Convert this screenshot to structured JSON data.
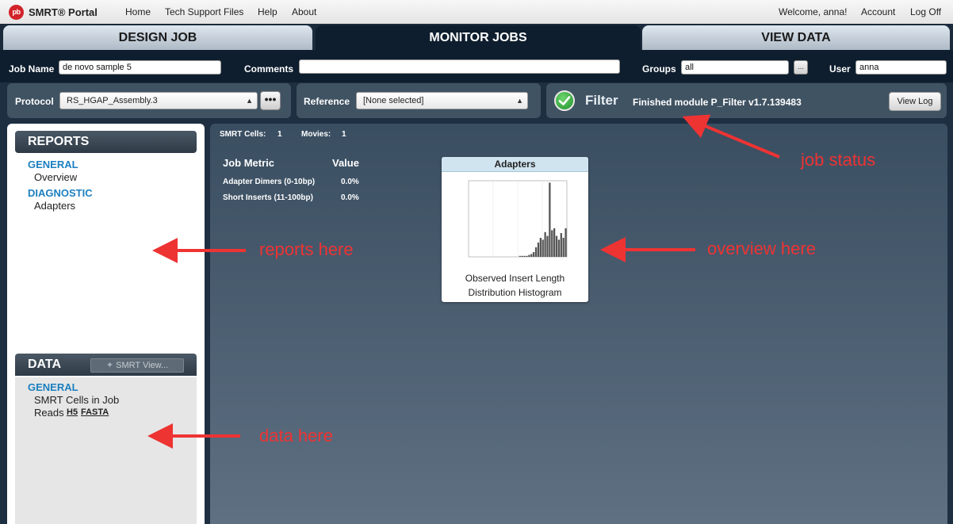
{
  "app": {
    "logo_mark": "pb",
    "name": "SMRT® Portal"
  },
  "menu": {
    "home": "Home",
    "tech_support": "Tech Support Files",
    "help": "Help",
    "about": "About"
  },
  "user_menu": {
    "welcome": "Welcome, anna!",
    "account": "Account",
    "logoff": "Log Off"
  },
  "tabs": [
    {
      "label": "DESIGN JOB",
      "active": false
    },
    {
      "label": "MONITOR JOBS",
      "active": true
    },
    {
      "label": "VIEW DATA",
      "active": false
    }
  ],
  "job": {
    "name_label": "Job Name",
    "name_value": "de novo sample 5",
    "comments_label": "Comments",
    "comments_value": "",
    "groups_label": "Groups",
    "groups_value": "all",
    "groups_btn": "...",
    "user_label": "User",
    "user_value": "anna"
  },
  "protocol": {
    "label": "Protocol",
    "value": "RS_HGAP_Assembly.3",
    "more_btn": "•••"
  },
  "reference": {
    "label": "Reference",
    "value": "[None selected]"
  },
  "status": {
    "name": "Filter",
    "message": "Finished module P_Filter v1.7.139483",
    "view_log": "View Log",
    "icon": "checkmark-icon",
    "color": "#2a9d36"
  },
  "reports": {
    "header": "REPORTS",
    "groups": [
      {
        "category": "GENERAL",
        "items": [
          "Overview"
        ]
      },
      {
        "category": "DIAGNOSTIC",
        "items": [
          "Adapters"
        ]
      }
    ]
  },
  "data_panel": {
    "header": "DATA",
    "smrt_view_btn": "SMRT View...",
    "category": "GENERAL",
    "item1": "SMRT Cells in Job",
    "reads_label": "Reads",
    "reads_h5": "H5",
    "reads_fasta": "FASTA"
  },
  "summary": {
    "cells_label": "SMRT Cells:",
    "cells_value": "1",
    "movies_label": "Movies:",
    "movies_value": "1"
  },
  "metrics": {
    "col_metric": "Job Metric",
    "col_value": "Value",
    "rows": [
      {
        "metric": "Adapter Dimers (0-10bp)",
        "value": "0.0%"
      },
      {
        "metric": "Short Inserts (11-100bp)",
        "value": "0.0%"
      }
    ]
  },
  "adapters_card": {
    "title": "Adapters",
    "caption_line1": "Observed Insert Length",
    "caption_line2": "Distribution Histogram"
  },
  "chart_data": {
    "type": "bar",
    "values": [
      0,
      0,
      0,
      0,
      0,
      0,
      0,
      0,
      0,
      0,
      0,
      0,
      0,
      0,
      0,
      0,
      0,
      0,
      0,
      0,
      0,
      0,
      1,
      1,
      1,
      1,
      2,
      3,
      5,
      10,
      15,
      20,
      18,
      26,
      22,
      78,
      28,
      30,
      22,
      18,
      25,
      20,
      30
    ],
    "ylim": [
      0,
      80
    ]
  },
  "annotations": {
    "job_status": "job status",
    "reports": "reports here",
    "overview": "overview here",
    "data": "data here",
    "color": "#ee3333"
  }
}
